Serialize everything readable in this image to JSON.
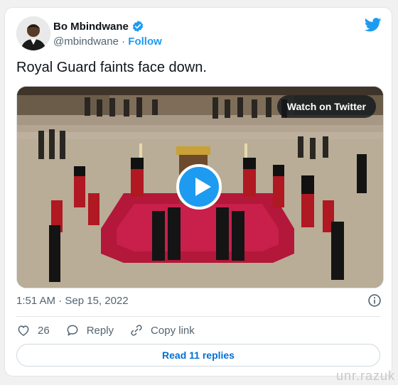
{
  "author": {
    "name": "Bo Mbindwane",
    "handle": "@mbindwane",
    "follow_label": "Follow",
    "separator": " · "
  },
  "tweet": {
    "text": "Royal Guard faints face down.",
    "timestamp": "1:51 AM · Sep 15, 2022"
  },
  "media": {
    "watch_label": "Watch on Twitter"
  },
  "actions": {
    "likes_count": "26",
    "reply_label": "Reply",
    "copy_link_label": "Copy link"
  },
  "replies_button": "Read 11 replies",
  "watermark": "unr.razuk",
  "icons": {
    "brand": "twitter-bird-icon",
    "verified": "verified-badge-icon",
    "info": "info-icon",
    "like": "heart-icon",
    "reply": "speech-bubble-icon",
    "link": "link-icon",
    "play": "play-icon"
  },
  "colors": {
    "accent": "#1d9bf0",
    "link_text": "#006fd6",
    "muted": "#536471",
    "text": "#0f1419"
  }
}
